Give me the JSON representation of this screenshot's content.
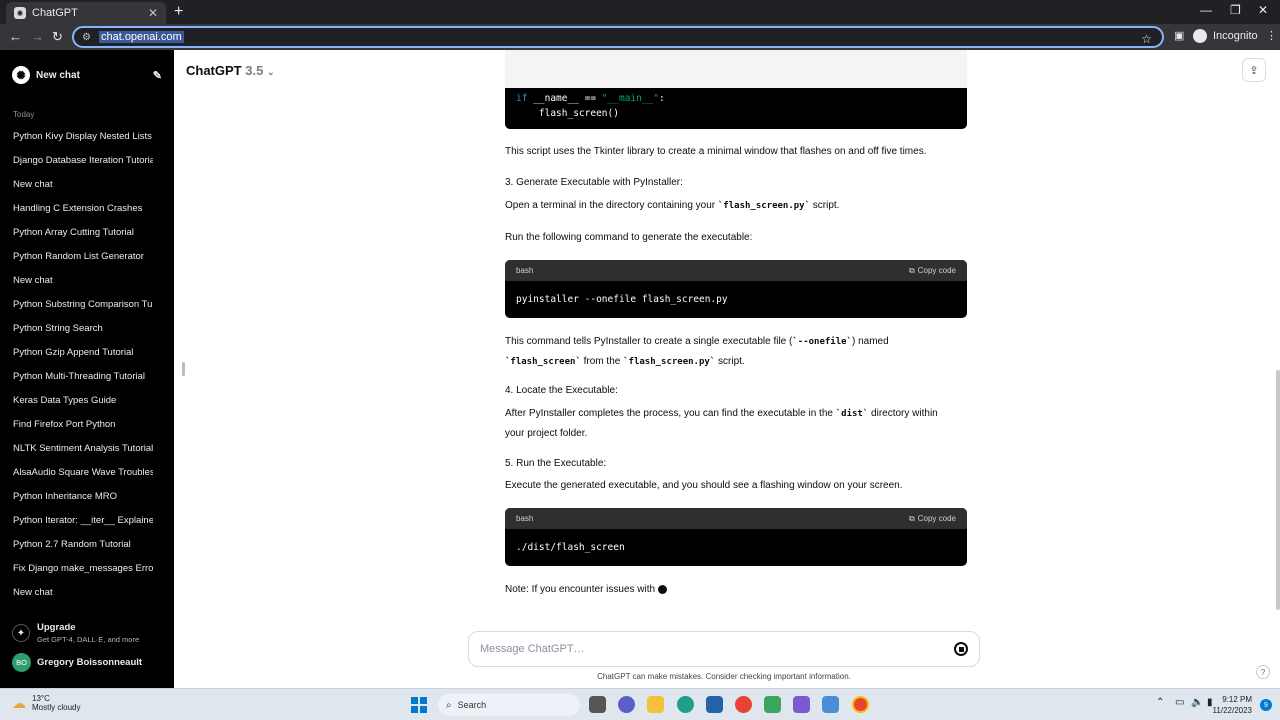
{
  "browser": {
    "tab_title": "ChatGPT",
    "url": "chat.openai.com",
    "profile_label": "Incognito",
    "new_tab": "+",
    "tab_close": "✕"
  },
  "sidebar": {
    "new_chat_label": "New chat",
    "section_today": "Today",
    "history": [
      "Python Kivy Display Nested Lists",
      "Django Database Iteration Tutorial",
      "New chat",
      "Handling C Extension Crashes",
      "Python Array Cutting Tutorial",
      "Python Random List Generator",
      "New chat",
      "Python Substring Comparison Tu",
      "Python String Search",
      "Python Gzip Append Tutorial",
      "Python Multi-Threading Tutorial",
      "Keras Data Types Guide",
      "Find Firefox Port Python",
      "NLTK Sentiment Analysis Tutorial",
      "AlsaAudio Square Wave Troubles",
      "Python Inheritance MRO",
      "Python Iterator: __iter__ Explained",
      "Python 2.7 Random Tutorial",
      "Fix Django make_messages Error",
      "New chat"
    ],
    "upgrade_title": "Upgrade",
    "upgrade_sub": "Get GPT-4, DALL·E, and more",
    "user_initials": "BO",
    "user_name": "Gregory Boissonneault"
  },
  "header": {
    "model_name": "ChatGPT",
    "model_version": "3.5"
  },
  "content": {
    "code_top_line1_kw": "if",
    "code_top_line1_rest": " __name__ == ",
    "code_top_line1_str": "\"__main__\"",
    "code_top_line1_end": ":",
    "code_top_line2": "    flash_screen()",
    "p1": "This script uses the Tkinter library to create a minimal window that flashes on and off five times.",
    "step3": "3. Generate Executable with PyInstaller:",
    "p2_a": "Open a terminal in the directory containing your ",
    "p2_code": "`flash_screen.py`",
    "p2_b": " script.",
    "p3": "Run the following command to generate the executable:",
    "code1_lang": "bash",
    "code1_copy": "Copy code",
    "code1_body": "pyinstaller --onefile flash_screen.py",
    "p4_a": "This command tells PyInstaller to create a single executable file (",
    "p4_code1": "`--onefile`",
    "p4_b": ") named",
    "p4_code2": "`flash_screen`",
    "p4_c": " from the ",
    "p4_code3": "`flash_screen.py`",
    "p4_d": " script.",
    "step4": "4. Locate the Executable:",
    "p5_a": "After PyInstaller completes the process, you can find the executable in the ",
    "p5_code": "`dist`",
    "p5_b": " directory within",
    "p5_c": "your project folder.",
    "step5": "5. Run the Executable:",
    "p6": "Execute the generated executable, and you should see a flashing window on your screen.",
    "code2_lang": "bash",
    "code2_copy": "Copy code",
    "code2_body": "./dist/flash_screen",
    "p7": "Note: If you encounter issues with"
  },
  "composer": {
    "placeholder": "Message ChatGPT…",
    "disclaimer": "ChatGPT can make mistakes. Consider checking important information.",
    "help": "?"
  },
  "taskbar": {
    "temp": "13°C",
    "weather": "Mostly cloudy",
    "search_label": "Search",
    "time": "9:12 PM",
    "date": "11/22/2023",
    "notif_count": "9"
  },
  "colors": {
    "accent": "#2e95d3",
    "string": "#00a67d",
    "sidebar_bg": "#000000",
    "avatar": "#2f9e6e"
  }
}
